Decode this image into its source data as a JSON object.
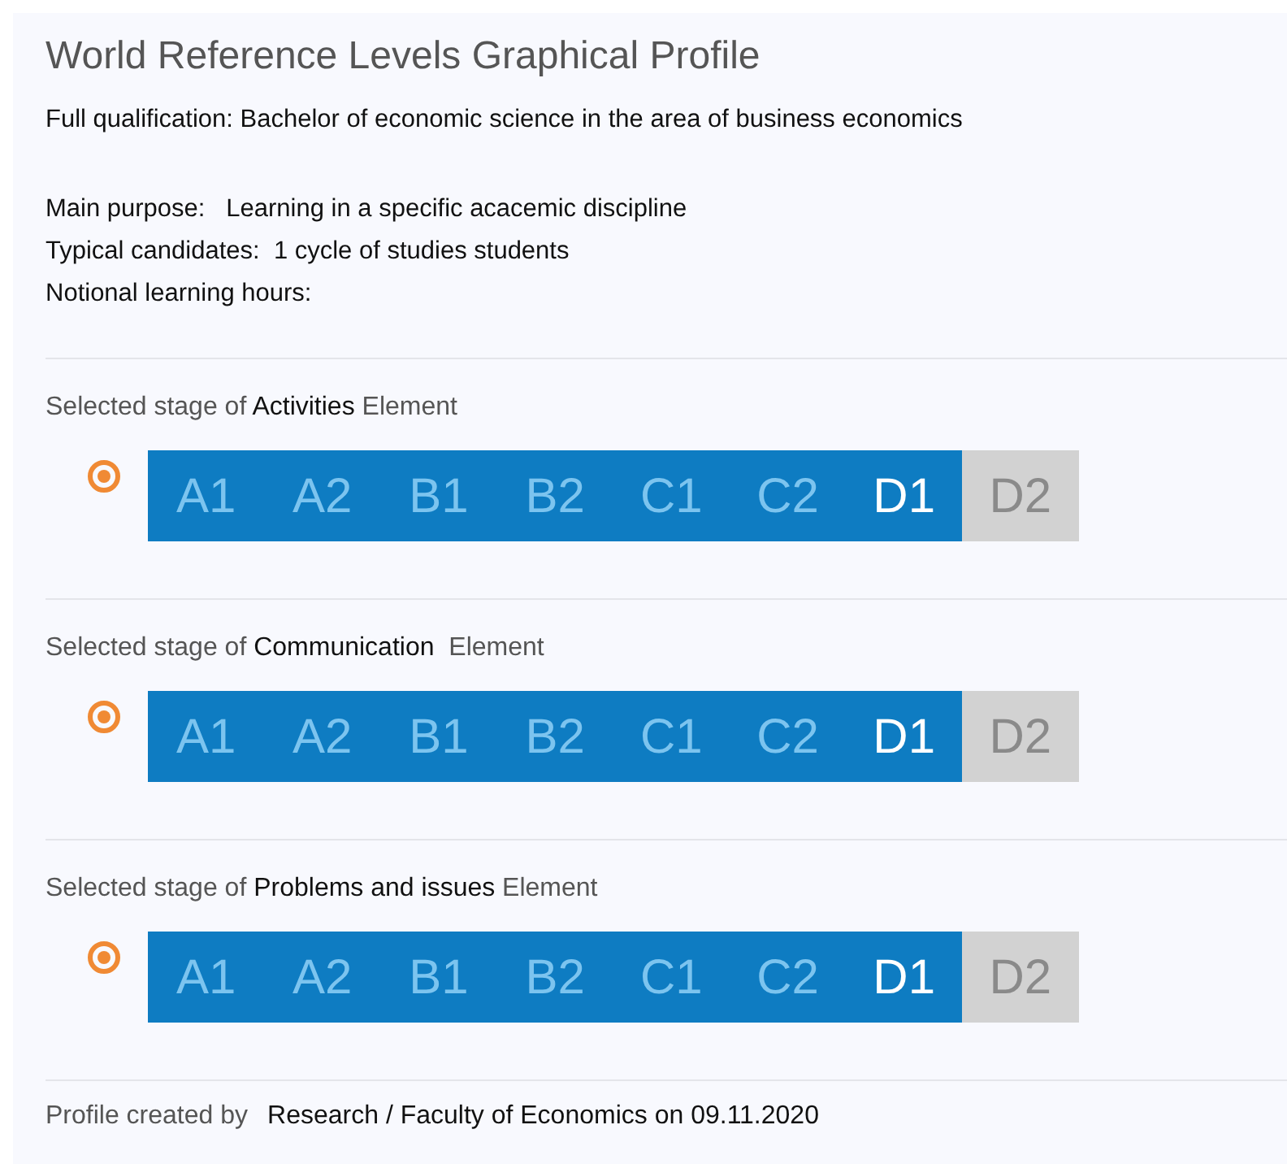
{
  "title": "World Reference Levels Graphical Profile",
  "qualification": "Full qualification: Bachelor of economic science in the area of business economics",
  "details": [
    "Main purpose:   Learning in a specific acacemic discipline",
    "Typical candidates:  1 cycle of studies students",
    "Notional learning hours:"
  ],
  "elements": [
    {
      "label": "Selected stage of **Activities** Element",
      "radio_checked": true,
      "levels": [
        {
          "label": "A1",
          "filled": true,
          "selected": false
        },
        {
          "label": "A2",
          "filled": true,
          "selected": false
        },
        {
          "label": "B1",
          "filled": true,
          "selected": false
        },
        {
          "label": "B2",
          "filled": true,
          "selected": false
        },
        {
          "label": "C1",
          "filled": true,
          "selected": false
        },
        {
          "label": "C2",
          "filled": true,
          "selected": false
        },
        {
          "label": "D1",
          "filled": true,
          "selected": true
        },
        {
          "label": "D2",
          "filled": false,
          "selected": false
        }
      ]
    },
    {
      "label": "Selected stage of **Communication**  Element",
      "radio_checked": true,
      "levels": [
        {
          "label": "A1",
          "filled": true,
          "selected": false
        },
        {
          "label": "A2",
          "filled": true,
          "selected": false
        },
        {
          "label": "B1",
          "filled": true,
          "selected": false
        },
        {
          "label": "B2",
          "filled": true,
          "selected": false
        },
        {
          "label": "C1",
          "filled": true,
          "selected": false
        },
        {
          "label": "C2",
          "filled": true,
          "selected": false
        },
        {
          "label": "D1",
          "filled": true,
          "selected": true
        },
        {
          "label": "D2",
          "filled": false,
          "selected": false
        }
      ]
    },
    {
      "label": "Selected stage of **Problems and issues** Element",
      "radio_checked": true,
      "levels": [
        {
          "label": "A1",
          "filled": true,
          "selected": false
        },
        {
          "label": "A2",
          "filled": true,
          "selected": false
        },
        {
          "label": "B1",
          "filled": true,
          "selected": false
        },
        {
          "label": "B2",
          "filled": true,
          "selected": false
        },
        {
          "label": "C1",
          "filled": true,
          "selected": false
        },
        {
          "label": "C2",
          "filled": true,
          "selected": false
        },
        {
          "label": "D1",
          "filled": true,
          "selected": true
        },
        {
          "label": "D2",
          "filled": false,
          "selected": false
        }
      ]
    }
  ],
  "footer": {
    "label": "Profile created by",
    "value": "Research / Faculty of Economics on 09.11.2020"
  }
}
